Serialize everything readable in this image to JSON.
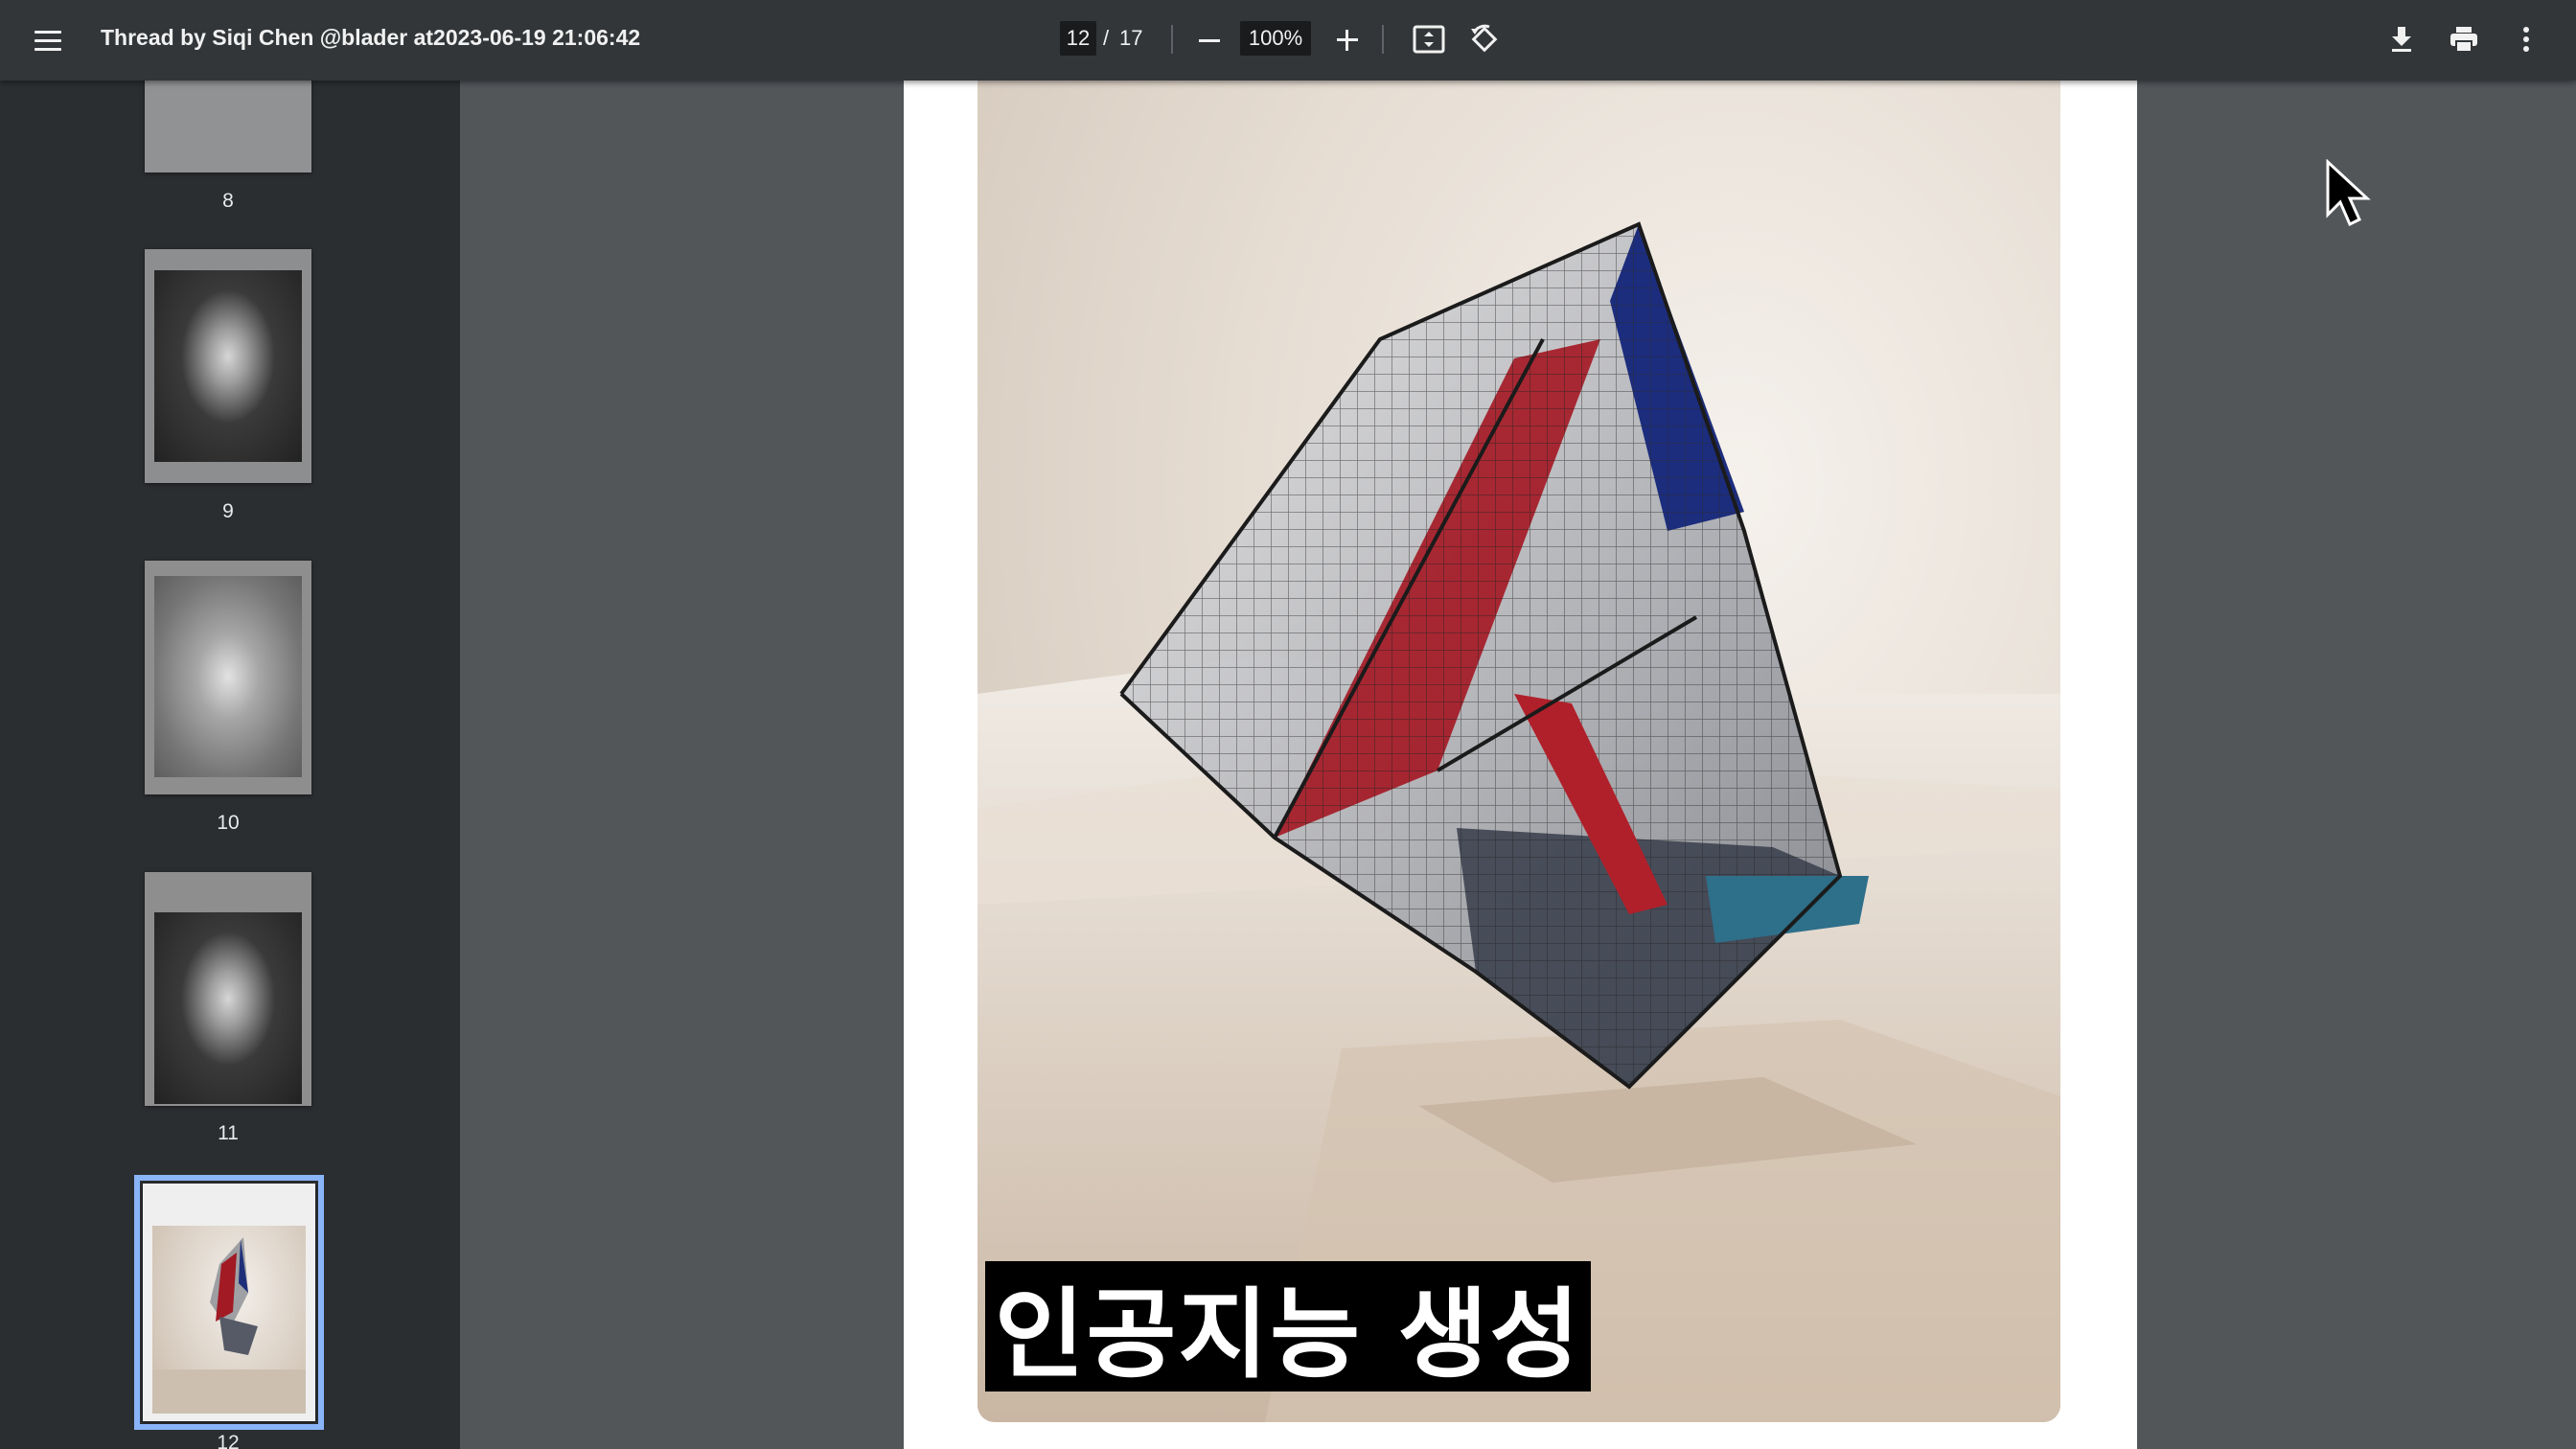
{
  "toolbar": {
    "title": "Thread by Siqi Chen @blader at2023-06-19 21:06:42",
    "current_page": "12",
    "page_separator": "/",
    "total_pages": "17",
    "zoom": "100%",
    "icons": {
      "menu": "menu-icon",
      "zoom_out": "minus-icon",
      "zoom_in": "plus-icon",
      "fit": "fit-to-page-icon",
      "rotate": "rotate-icon",
      "download": "download-icon",
      "print": "print-icon",
      "more": "more-vertical-icon"
    }
  },
  "sidebar": {
    "thumbnails": [
      {
        "label": "8"
      },
      {
        "label": "9"
      },
      {
        "label": "10"
      },
      {
        "label": "11"
      },
      {
        "label": "12",
        "selected": true
      }
    ]
  },
  "document": {
    "caption": "인공지능 생성"
  },
  "colors": {
    "toolbar_bg": "#323639",
    "sidebar_bg": "#2b2e31",
    "viewer_bg": "#525659",
    "selection": "#8ab4f8"
  }
}
